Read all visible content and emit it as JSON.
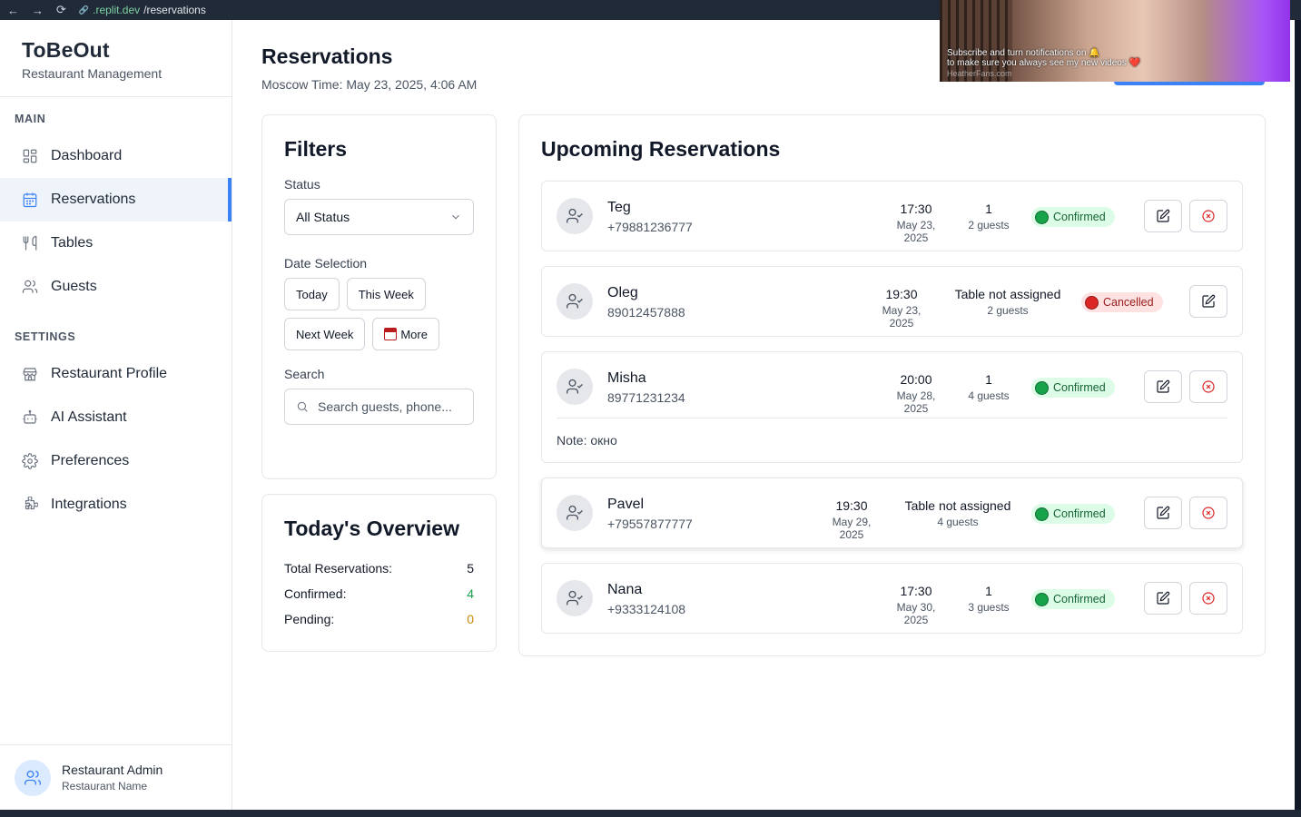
{
  "browser": {
    "back_glyph": "←",
    "forward_glyph": "→",
    "reload_glyph": "⟳",
    "link_glyph": "🔗",
    "url_domain": ".replit.dev",
    "url_path": "/reservations"
  },
  "sidebar": {
    "brand_title": "ToBeOut",
    "brand_sub": "Restaurant Management",
    "main_label": "MAIN",
    "settings_label": "SETTINGS",
    "main_items": [
      {
        "label": "Dashboard",
        "icon": "dashboard-icon"
      },
      {
        "label": "Reservations",
        "icon": "calendar-icon",
        "active": true
      },
      {
        "label": "Tables",
        "icon": "utensils-icon"
      },
      {
        "label": "Guests",
        "icon": "users-icon"
      }
    ],
    "settings_items": [
      {
        "label": "Restaurant Profile",
        "icon": "store-icon"
      },
      {
        "label": "AI Assistant",
        "icon": "bot-icon"
      },
      {
        "label": "Preferences",
        "icon": "gear-icon"
      },
      {
        "label": "Integrations",
        "icon": "puzzle-icon"
      }
    ],
    "user": {
      "name": "Restaurant Admin",
      "role": "Restaurant Name"
    }
  },
  "header": {
    "title": "Reservations",
    "time": "Moscow Time: May 23, 2025, 4:06 AM"
  },
  "filters": {
    "title": "Filters",
    "status_label": "Status",
    "status_value": "All Status",
    "date_label": "Date Selection",
    "date_buttons": [
      "Today",
      "This Week",
      "Next Week",
      "More"
    ],
    "search_label": "Search",
    "search_placeholder": "Search guests, phone..."
  },
  "overview": {
    "title": "Today's Overview",
    "rows": [
      {
        "label": "Total Reservations:",
        "value": "5"
      },
      {
        "label": "Confirmed:",
        "value": "4"
      },
      {
        "label": "Pending:",
        "value": "0"
      }
    ]
  },
  "reservations": {
    "title": "Upcoming Reservations",
    "items": [
      {
        "name": "Teg",
        "phone": "+79881236777",
        "time": "17:30",
        "date": "May 23, 2025",
        "table": "1",
        "guests": "2 guests",
        "status": "Confirmed"
      },
      {
        "name": "Oleg",
        "phone": "89012457888",
        "time": "19:30",
        "date": "May 23, 2025",
        "table": "Table not assigned",
        "guests": "2 guests",
        "status": "Cancelled"
      },
      {
        "name": "Misha",
        "phone": "89771231234",
        "time": "20:00",
        "date": "May 28, 2025",
        "table": "1",
        "guests": "4 guests",
        "status": "Confirmed",
        "note": "Note: окно"
      },
      {
        "name": "Pavel",
        "phone": "+79557877777",
        "time": "19:30",
        "date": "May 29, 2025",
        "table": "Table not assigned",
        "guests": "4 guests",
        "status": "Confirmed"
      },
      {
        "name": "Nana",
        "phone": "+9333124108",
        "time": "17:30",
        "date": "May 30, 2025",
        "table": "1",
        "guests": "3 guests",
        "status": "Confirmed"
      }
    ]
  },
  "video_overlay": {
    "caption_line1": "Subscribe and turn notifications on 🔔",
    "caption_line2": "to make sure you always see my new videos ❤️",
    "caption_line3": "HeatherFans.com"
  },
  "colors": {
    "accent": "#3b82f6",
    "confirmed": "#16a34a",
    "cancelled": "#dc2626",
    "pending": "#ca8a04"
  }
}
